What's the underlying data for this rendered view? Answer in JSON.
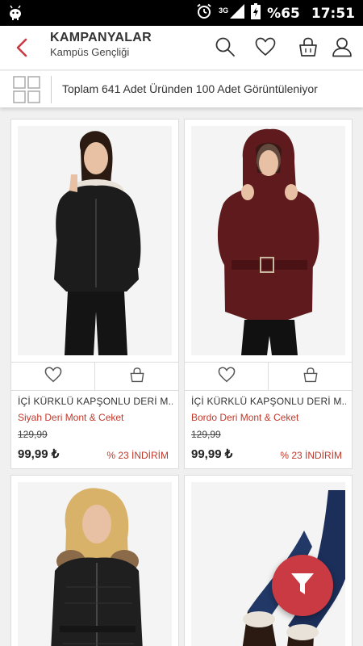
{
  "status_bar": {
    "network": "3G",
    "battery": "%65",
    "time": "17:51"
  },
  "header": {
    "title": "KAMPANYALAR",
    "subtitle": "Kampüs Gençliği"
  },
  "info_bar": {
    "count_text": "Toplam 641 Adet Üründen 100 Adet Görüntüleniyor"
  },
  "products": [
    {
      "name": "İÇİ KÜRKLÜ KAPŞONLU DERİ M...",
      "category": "Siyah Deri Mont & Ceket",
      "old_price": "129,99",
      "price": "99,99 ₺",
      "discount": "% 23 İNDİRİM",
      "jacket_color": "#1c1c1c"
    },
    {
      "name": "İÇİ KÜRKLÜ KAPŞONLU DERİ M...",
      "category": "Bordo Deri Mont & Ceket",
      "old_price": "129,99",
      "price": "99,99 ₺",
      "discount": "% 23 İNDİRİM",
      "jacket_color": "#5e1a1c"
    },
    {
      "jacket_color": "#1f1f1f"
    },
    {
      "jacket_color": "#1c2f5a"
    }
  ],
  "colors": {
    "accent": "#c93a42",
    "discount_text": "#c0392b"
  }
}
